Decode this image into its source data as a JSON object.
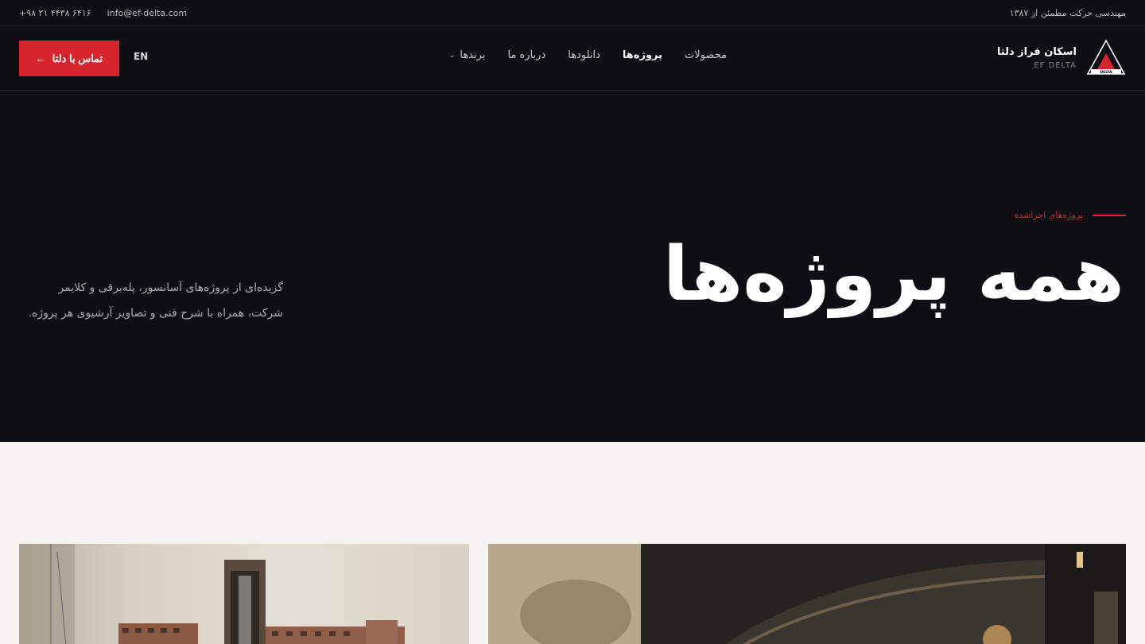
{
  "topbar": {
    "phone": "+۹۸ ۲۱ ۴۴۳۸ ۶۴۱۶",
    "email": "info@ef-delta.com",
    "tagline": "مهندسی حرکت مطمئن از ۱۳۸۷"
  },
  "header": {
    "cta_label": "تماس با دلتا",
    "lang_label": "EN",
    "nav": [
      {
        "label": "محصولات"
      },
      {
        "label": "پروژه‌ها"
      },
      {
        "label": "دانلودها"
      },
      {
        "label": "درباره ما"
      },
      {
        "label": "برندها"
      }
    ],
    "brand_name_fa": "اسکان فراز دلتا",
    "brand_name_en": "EF DELTA",
    "logo_text": "DELTA",
    "accent": "#d6252c"
  },
  "hero": {
    "eyebrow": "پروژه‌های اجراشده",
    "title": "همه پروژه‌ها",
    "description": "گزیده‌ای از پروژه‌های آسانسور، پله‌برقی و کلایمر شرکت، همراه با شرح فنی و تصاویر آرشیوی هر پروژه."
  },
  "icons": {
    "cta_arrow": "arrow-left-icon",
    "dropdown": "chevron-down-icon",
    "logo": "delta-triangle-logo-icon"
  }
}
